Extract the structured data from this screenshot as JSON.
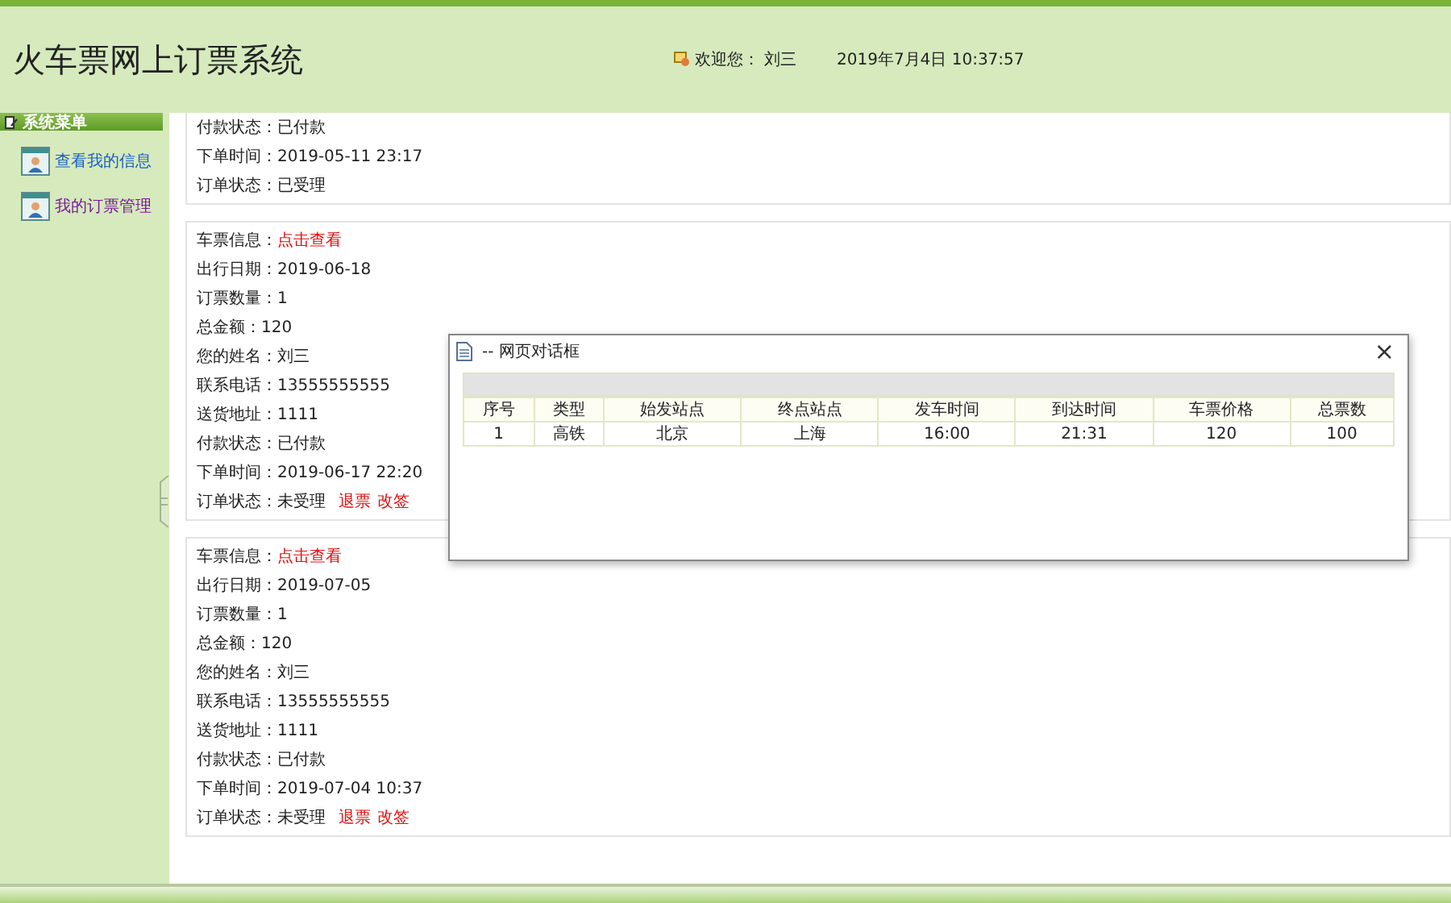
{
  "header": {
    "title": "火车票网上订票系统",
    "welcome_label": "欢迎您：",
    "user": "刘三",
    "datetime": "2019年7月4日 10:37:57"
  },
  "sidebar": {
    "title": "系统菜单",
    "items": [
      {
        "label": "查看我的信息",
        "visited": false
      },
      {
        "label": "我的订票管理",
        "visited": true
      }
    ]
  },
  "orders": [
    {
      "fields": [
        {
          "kind": "text",
          "label": "付款状态：",
          "value": "已付款"
        },
        {
          "kind": "text",
          "label": "下单时间：",
          "value": "2019-05-11 23:17"
        },
        {
          "kind": "text",
          "label": "订单状态：",
          "value": "已受理"
        }
      ]
    },
    {
      "fields": [
        {
          "kind": "link",
          "label": "车票信息：",
          "value": "点击查看"
        },
        {
          "kind": "text",
          "label": "出行日期：",
          "value": "2019-06-18"
        },
        {
          "kind": "text",
          "label": "订票数量：",
          "value": "1"
        },
        {
          "kind": "text",
          "label": "总金额：",
          "value": "120"
        },
        {
          "kind": "text",
          "label": "您的姓名：",
          "value": "刘三"
        },
        {
          "kind": "text",
          "label": "联系电话：",
          "value": "13555555555"
        },
        {
          "kind": "text",
          "label": "送货地址：",
          "value": "1111"
        },
        {
          "kind": "text",
          "label": "付款状态：",
          "value": "已付款"
        },
        {
          "kind": "text",
          "label": "下单时间：",
          "value": "2019-06-17 22:20"
        },
        {
          "kind": "status",
          "label": "订单状态：",
          "value": "未受理",
          "actions": [
            "退票",
            "改签"
          ]
        }
      ]
    },
    {
      "fields": [
        {
          "kind": "link",
          "label": "车票信息：",
          "value": "点击查看"
        },
        {
          "kind": "text",
          "label": "出行日期：",
          "value": "2019-07-05"
        },
        {
          "kind": "text",
          "label": "订票数量：",
          "value": "1"
        },
        {
          "kind": "text",
          "label": "总金额：",
          "value": "120"
        },
        {
          "kind": "text",
          "label": "您的姓名：",
          "value": "刘三"
        },
        {
          "kind": "text",
          "label": "联系电话：",
          "value": "13555555555"
        },
        {
          "kind": "text",
          "label": "送货地址：",
          "value": "1111"
        },
        {
          "kind": "text",
          "label": "付款状态：",
          "value": "已付款"
        },
        {
          "kind": "text",
          "label": "下单时间：",
          "value": "2019-07-04 10:37"
        },
        {
          "kind": "status",
          "label": "订单状态：",
          "value": "未受理",
          "actions": [
            "退票",
            "改签"
          ]
        }
      ]
    }
  ],
  "dialog": {
    "title": "-- 网页对话框",
    "close": "×",
    "table": {
      "columns": [
        "序号",
        "类型",
        "始发站点",
        "终点站点",
        "发车时间",
        "到达时间",
        "车票价格",
        "总票数"
      ],
      "rows": [
        [
          "1",
          "高铁",
          "北京",
          "上海",
          "16:00",
          "21:31",
          "120",
          "100"
        ]
      ]
    }
  }
}
